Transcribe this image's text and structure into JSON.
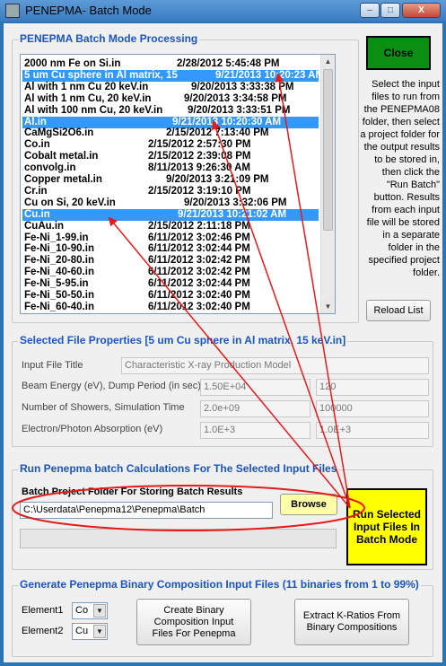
{
  "window": {
    "title": "PENEPMA- Batch Mode",
    "min": "–",
    "max": "□",
    "close": "X"
  },
  "batch_group": {
    "title": "PENEPMA Batch Mode Processing"
  },
  "files": [
    {
      "name": "2000 nm Fe on Si.in",
      "date": "2/28/2012 5:45:48 PM",
      "selected": false
    },
    {
      "name": "5 um Cu sphere in Al matrix, 15",
      "date": "9/21/2013 10:20:23 AM",
      "selected": true
    },
    {
      "name": "Al with 1 nm Cu 20 keV.in",
      "date": "9/20/2013 3:33:38 PM",
      "selected": false
    },
    {
      "name": "Al with 1 nm Cu, 20 keV.in",
      "date": "9/20/2013 3:34:58 PM",
      "selected": false
    },
    {
      "name": "Al with 100 nm Cu, 20 keV.in",
      "date": "9/20/2013 3:33:51 PM",
      "selected": false
    },
    {
      "name": "Al.in",
      "date": "9/21/2013 10:20:30 AM",
      "selected": true
    },
    {
      "name": "CaMgSi2O6.in",
      "date": "2/15/2012 7:13:40 PM",
      "selected": false
    },
    {
      "name": "Co.in",
      "date": "2/15/2012 2:57:30 PM",
      "selected": false
    },
    {
      "name": "Cobalt metal.in",
      "date": "2/15/2012 2:39:08 PM",
      "selected": false
    },
    {
      "name": "convolg.in",
      "date": "8/11/2013 9:26:30 AM",
      "selected": false
    },
    {
      "name": "Copper metal.in",
      "date": "9/20/2013 3:21:09 PM",
      "selected": false
    },
    {
      "name": "Cr.in",
      "date": "2/15/2012 3:19:10 PM",
      "selected": false
    },
    {
      "name": "Cu on Si, 20 keV.in",
      "date": "9/20/2013 3:32:06 PM",
      "selected": false
    },
    {
      "name": "Cu.in",
      "date": "9/21/2013 10:21:02 AM",
      "selected": true
    },
    {
      "name": "CuAu.in",
      "date": "2/15/2012 2:11:18 PM",
      "selected": false
    },
    {
      "name": "Fe-Ni_1-99.in",
      "date": "6/11/2012 3:02:46 PM",
      "selected": false
    },
    {
      "name": "Fe-Ni_10-90.in",
      "date": "6/11/2012 3:02:44 PM",
      "selected": false
    },
    {
      "name": "Fe-Ni_20-80.in",
      "date": "6/11/2012 3:02:42 PM",
      "selected": false
    },
    {
      "name": "Fe-Ni_40-60.in",
      "date": "6/11/2012 3:02:42 PM",
      "selected": false
    },
    {
      "name": "Fe-Ni_5-95.in",
      "date": "6/11/2012 3:02:44 PM",
      "selected": false
    },
    {
      "name": "Fe-Ni_50-50.in",
      "date": "6/11/2012 3:02:40 PM",
      "selected": false
    },
    {
      "name": "Fe-Ni_60-40.in",
      "date": "6/11/2012 3:02:40 PM",
      "selected": false
    }
  ],
  "close_button": "Close",
  "help_text": "Select the input files to run from the PENEPMA08 folder, then select a project folder for the output results to be stored in, then click the \"Run Batch\" button. Results from each input file will be stored in a separate folder in the specified project folder.",
  "reload_button": "Reload List",
  "properties": {
    "title": "Selected File Properties [5 um Cu sphere in Al matrix, 15 keV.in]",
    "input_title_label": "Input File Title",
    "input_title_value": "Characteristic X-ray Production Model",
    "beam_label": "Beam Energy (eV), Dump Period (in sec)",
    "beam_value": "1.50E+04",
    "dump_value": "120",
    "showers_label": "Number of Showers, Simulation Time",
    "showers_value": "2.0e+09",
    "time_value": "100000",
    "absorption_label": "Electron/Photon Absorption (eV)",
    "electron_abs_value": "1.0E+3",
    "photon_abs_value": "1.0E+3"
  },
  "run_group": {
    "title": "Run Penepma batch Calculations For The Selected Input Files",
    "folder_label": "Batch Project Folder For Storing Batch Results",
    "folder_value": "C:\\Userdata\\Penepma12\\Penepma\\Batch",
    "browse_button": "Browse",
    "run_button": "Run Selected Input Files In Batch Mode",
    "progress": 0
  },
  "binary_group": {
    "title": "Generate Penepma Binary Composition Input Files (11 binaries from 1 to 99%)",
    "element1_label": "Element1",
    "element1_value": "Co",
    "element2_label": "Element2",
    "element2_value": "Cu",
    "create_button": "Create Binary Composition Input Files For Penepma",
    "extract_button": "Extract K-Ratios From Binary Compositions"
  },
  "colors": {
    "selection": "#3399ff",
    "group_title": "#1a55c2",
    "close_green": "#0a8f12",
    "run_yellow": "#ffff00",
    "annotation_red": "#e31b1b"
  }
}
